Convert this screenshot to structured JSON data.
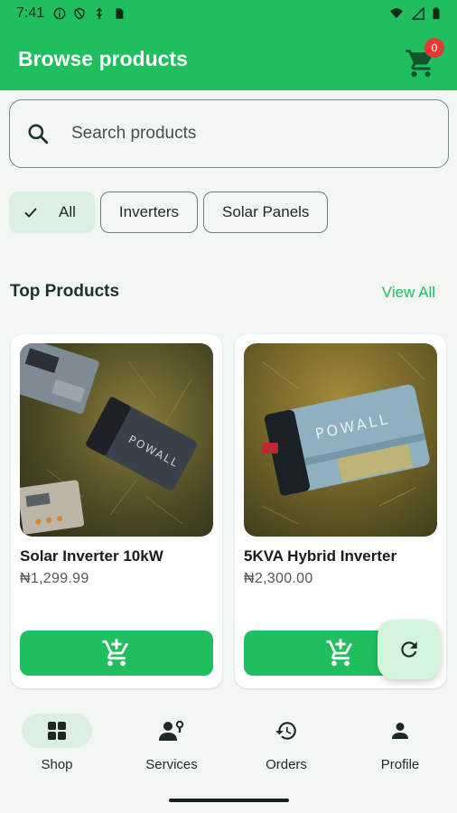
{
  "status_bar": {
    "time": "7:41"
  },
  "app_bar": {
    "title": "Browse products",
    "cart_count": "0"
  },
  "search": {
    "placeholder": "Search products"
  },
  "filters": [
    {
      "label": "All",
      "selected": true
    },
    {
      "label": "Inverters",
      "selected": false
    },
    {
      "label": "Solar Panels",
      "selected": false
    }
  ],
  "section": {
    "title": "Top Products",
    "view_all": "View All"
  },
  "products": [
    {
      "name": "Solar Inverter 10kW",
      "price": "₦1,299.99",
      "image": "inverter-on-grass-photo"
    },
    {
      "name": "5KVA Hybrid Inverter",
      "price": "₦2,300.00",
      "image": "powall-battery-on-grass-photo"
    }
  ],
  "bottom_nav": [
    {
      "label": "Shop",
      "icon": "grid-icon",
      "active": true
    },
    {
      "label": "Services",
      "icon": "services-icon",
      "active": false
    },
    {
      "label": "Orders",
      "icon": "history-icon",
      "active": false
    },
    {
      "label": "Profile",
      "icon": "person-icon",
      "active": false
    }
  ],
  "colors": {
    "brand": "#1fbe5f",
    "badge": "#e53935",
    "chip_selected": "#dcefe2"
  }
}
